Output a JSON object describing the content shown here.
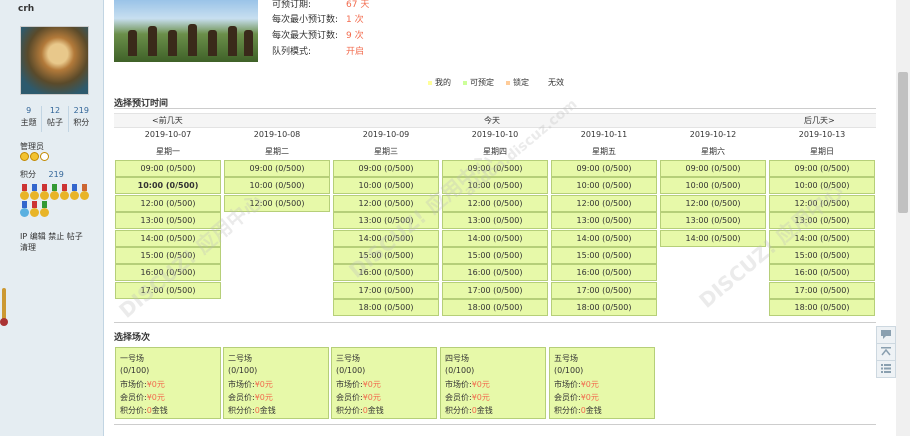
{
  "sidebar": {
    "username": "crh",
    "stats": [
      {
        "value": "9",
        "label": "主题"
      },
      {
        "value": "12",
        "label": "帖子"
      },
      {
        "value": "219",
        "label": "积分"
      }
    ],
    "role": "管理员",
    "points_label": "积分",
    "points_value": "219",
    "actions": "IP 编辑 禁止 帖子 清理"
  },
  "info": [
    {
      "label": "可预订期:",
      "value": "67 天"
    },
    {
      "label": "每次最小预订数:",
      "value": "1 次"
    },
    {
      "label": "每次最大预订数:",
      "value": "9 次"
    },
    {
      "label": "队列模式:",
      "value": "开启"
    }
  ],
  "legend": [
    "我的",
    "可预定",
    "锁定",
    "无效"
  ],
  "booking": {
    "title": "选择预订时间",
    "prev": "<前几天",
    "today": "今天",
    "next": "后几天>",
    "days": [
      {
        "date": "2019-10-07",
        "weekday": "星期一",
        "slots": [
          "09:00 (0/500)",
          "10:00 (0/500)",
          "12:00 (0/500)",
          "13:00 (0/500)",
          "14:00 (0/500)",
          "15:00 (0/500)",
          "16:00 (0/500)",
          "17:00 (0/500)"
        ],
        "bold_index": 1
      },
      {
        "date": "2019-10-08",
        "weekday": "星期二",
        "slots": [
          "09:00 (0/500)",
          "10:00 (0/500)",
          "12:00 (0/500)"
        ]
      },
      {
        "date": "2019-10-09",
        "weekday": "星期三",
        "slots": [
          "09:00 (0/500)",
          "10:00 (0/500)",
          "12:00 (0/500)",
          "13:00 (0/500)",
          "14:00 (0/500)",
          "15:00 (0/500)",
          "16:00 (0/500)",
          "17:00 (0/500)",
          "18:00 (0/500)"
        ]
      },
      {
        "date": "2019-10-10",
        "weekday": "星期四",
        "slots": [
          "09:00 (0/500)",
          "10:00 (0/500)",
          "12:00 (0/500)",
          "13:00 (0/500)",
          "14:00 (0/500)",
          "15:00 (0/500)",
          "16:00 (0/500)",
          "17:00 (0/500)",
          "18:00 (0/500)"
        ]
      },
      {
        "date": "2019-10-11",
        "weekday": "星期五",
        "slots": [
          "09:00 (0/500)",
          "10:00 (0/500)",
          "12:00 (0/500)",
          "13:00 (0/500)",
          "14:00 (0/500)",
          "15:00 (0/500)",
          "16:00 (0/500)",
          "17:00 (0/500)",
          "18:00 (0/500)"
        ]
      },
      {
        "date": "2019-10-12",
        "weekday": "星期六",
        "slots": [
          "09:00 (0/500)",
          "10:00 (0/500)",
          "12:00 (0/500)",
          "13:00 (0/500)",
          "14:00 (0/500)"
        ]
      },
      {
        "date": "2019-10-13",
        "weekday": "星期日",
        "slots": [
          "09:00 (0/500)",
          "10:00 (0/500)",
          "12:00 (0/500)",
          "13:00 (0/500)",
          "14:00 (0/500)",
          "15:00 (0/500)",
          "16:00 (0/500)",
          "17:00 (0/500)",
          "18:00 (0/500)"
        ]
      }
    ]
  },
  "sessions": {
    "title": "选择场次",
    "items": [
      {
        "name": "一号场",
        "count": "(0/100)",
        "market_label": "市场价:",
        "market": "¥0元",
        "member_label": "会员价:",
        "member": "¥0元",
        "points_label": "积分价:",
        "points": "0",
        "points_unit": "金钱"
      },
      {
        "name": "二号场",
        "count": "(0/100)",
        "market_label": "市场价:",
        "market": "¥0元",
        "member_label": "会员价:",
        "member": "¥0元",
        "points_label": "积分价:",
        "points": "0",
        "points_unit": "金钱"
      },
      {
        "name": "三号场",
        "count": "(0/100)",
        "market_label": "市场价:",
        "market": "¥0元",
        "member_label": "会员价:",
        "member": "¥0元",
        "points_label": "积分价:",
        "points": "0",
        "points_unit": "金钱"
      },
      {
        "name": "四号场",
        "count": "(0/100)",
        "market_label": "市场价:",
        "market": "¥0元",
        "member_label": "会员价:",
        "member": "¥0元",
        "points_label": "积分价:",
        "points": "0",
        "points_unit": "金钱"
      },
      {
        "name": "五号场",
        "count": "(0/100)",
        "market_label": "市场价:",
        "market": "¥0元",
        "member_label": "会员价:",
        "member": "¥0元",
        "points_label": "积分价:",
        "points": "0",
        "points_unit": "金钱"
      }
    ]
  },
  "watermark": "DISCUZ! 应用中心",
  "watermark_sub": "addon.discuz.com",
  "icons": [
    "comment-icon",
    "back-to-top-icon",
    "list-icon"
  ],
  "colors": {
    "slot_bg": "#e7f9a9",
    "slot_border": "#b6cf79",
    "price_red": "#f26c4f",
    "link_blue": "#336699"
  }
}
